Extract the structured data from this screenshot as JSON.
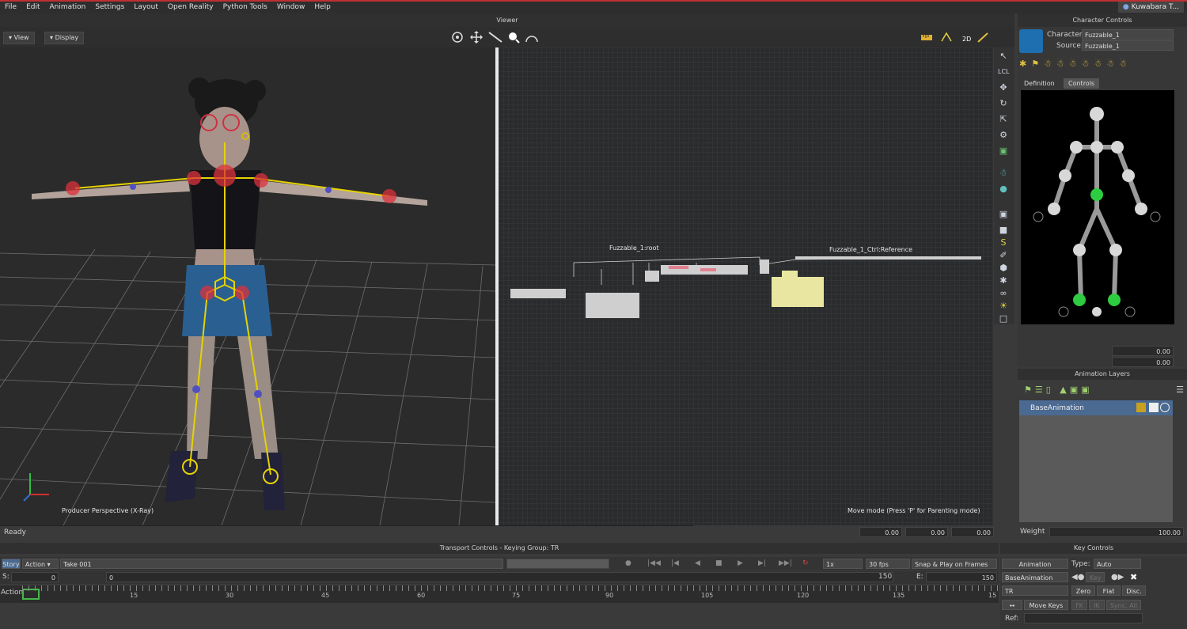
{
  "menu": [
    "File",
    "Edit",
    "Animation",
    "Settings",
    "Layout",
    "Open Reality",
    "Python Tools",
    "Window",
    "Help"
  ],
  "user": "Kuwabara T...",
  "viewer": {
    "title": "Viewer",
    "view_btn": "View",
    "display_btn": "Display",
    "left_label": "Producer Perspective (X-Ray)",
    "right_label": "Move mode (Press 'P' for Parenting mode)",
    "schematic_root": "Fuzzable_1:root",
    "schematic_ref": "Fuzzable_1_Ctrl:Reference"
  },
  "status": {
    "text": "Ready",
    "fields": [
      "0.00",
      "0.00",
      "0.00"
    ]
  },
  "transport": {
    "title": "Transport Controls  -  Keying Group: TR",
    "story": "Story",
    "action": "Action",
    "take": "Take 001",
    "speed": "1x",
    "fps": "30 fps",
    "snap": "Snap & Play on Frames",
    "s_label": "S:",
    "s_value": "0",
    "current": "0",
    "end_marker": "150",
    "e_label": "E:",
    "e_value": "150",
    "track_label": "Action",
    "ticks": [
      "15",
      "30",
      "45",
      "60",
      "75",
      "90",
      "105",
      "120",
      "135",
      "15"
    ]
  },
  "character_controls": {
    "title": "Character Controls",
    "character_label": "Character:",
    "character_value": "Fuzzable_1",
    "source_label": "Source:",
    "source_value": "Fuzzable_1",
    "tabs": [
      "Definition",
      "Controls"
    ],
    "active_tab": "Controls",
    "value_fields": [
      "0.00",
      "0.00"
    ]
  },
  "animation_layers": {
    "title": "Animation Layers",
    "layers": [
      "BaseAnimation"
    ],
    "weight_label": "Weight",
    "weight_value": "100.00"
  },
  "key_controls": {
    "title": "Key Controls",
    "animation": "Animation",
    "type_label": "Type:",
    "type_value": "Auto",
    "layer": "BaseAnimation",
    "key": "Key",
    "group": "TR",
    "zero": "Zero",
    "flat": "Flat",
    "disc": "Disc.",
    "move_keys": "Move Keys",
    "fk": "FK",
    "ik": "IK",
    "sync": "Sync. All",
    "ref_label": "Ref:"
  },
  "colors": {
    "accent_red": "#c03030",
    "selection_blue": "#4b6a92",
    "effector_green": "#2ecc40",
    "skeleton_yellow": "#e6d200"
  }
}
